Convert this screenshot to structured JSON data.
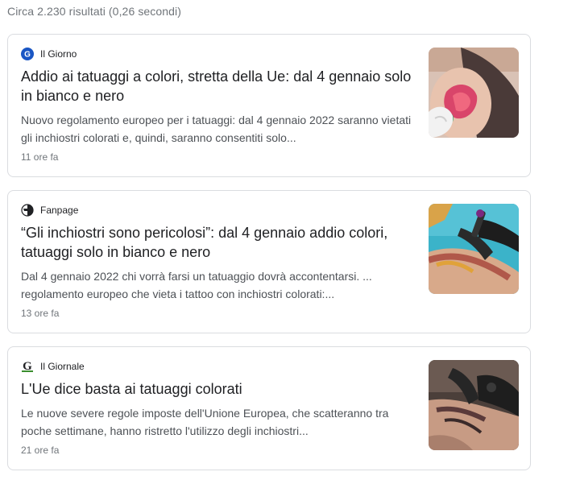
{
  "stats": "Circa 2.230 risultati (0,26 secondi)",
  "results": [
    {
      "source": "Il Giorno",
      "source_icon": "il-giorno-logo-icon",
      "title": "Addio ai tatuaggi a colori, stretta della Ue: dal 4 gennaio solo in bianco e nero",
      "snippet": "Nuovo regolamento europeo per i tatuaggi: dal 4 gennaio 2022 saranno vietati gli inchiostri colorati e, quindi, saranno consentiti solo...",
      "age": "11 ore fa",
      "thumbnail": "tattoo-shoulder-thumbnail"
    },
    {
      "source": "Fanpage",
      "source_icon": "fanpage-logo-icon",
      "title": "“Gli inchiostri sono pericolosi”: dal 4 gennaio addio colori, tatuaggi solo in bianco e nero",
      "snippet": "Dal 4 gennaio 2022 chi vorrà farsi un tatuaggio dovrà accontentarsi. ... regolamento europeo che vieta i tattoo con inchiostri colorati:...",
      "age": "13 ore fa",
      "thumbnail": "tattoo-arm-thumbnail"
    },
    {
      "source": "Il Giornale",
      "source_icon": "il-giornale-logo-icon",
      "title": "L'Ue dice basta ai tatuaggi colorati",
      "snippet": "Le nuove severe regole imposte dell'Unione Europea, che scatteranno tra poche settimane, hanno ristretto l'utilizzo degli inchiostri...",
      "age": "21 ore fa",
      "thumbnail": "tattoo-hands-thumbnail"
    }
  ],
  "colors": {
    "text": "#202124",
    "snippet": "#4d5156",
    "meta": "#70757a",
    "border": "#dadce0",
    "il_giorno_blue": "#1a56c4",
    "il_giornale_green": "#3a8d2e"
  }
}
